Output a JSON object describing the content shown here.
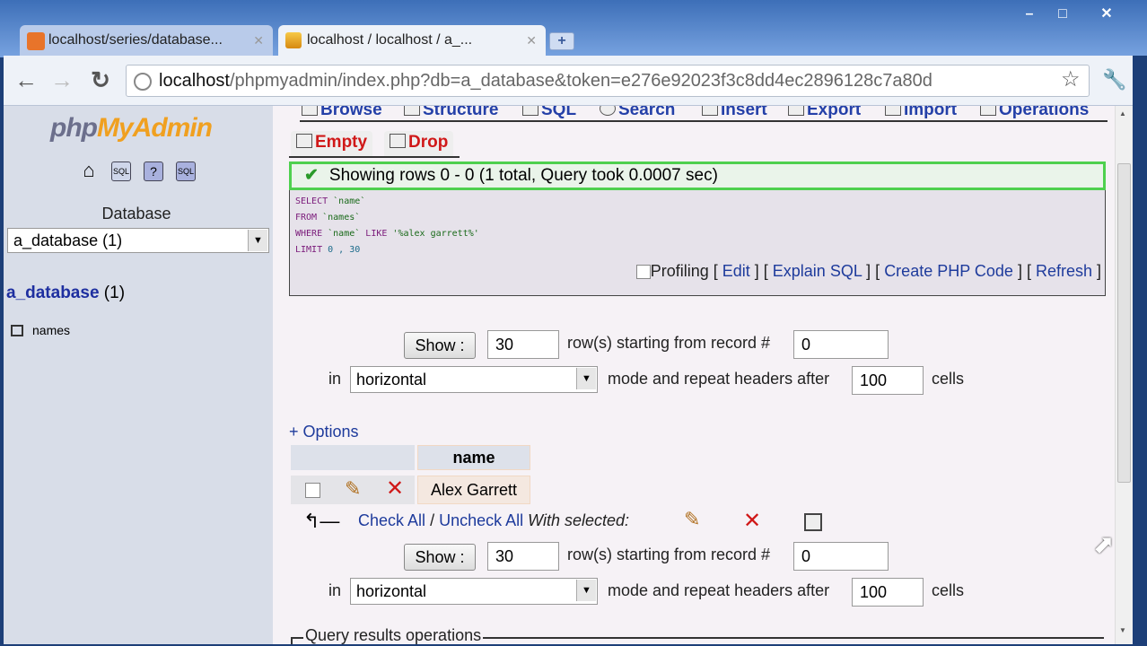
{
  "browser": {
    "tabs": [
      {
        "label": "localhost/series/database...",
        "icon": "xampp-icon",
        "active": false
      },
      {
        "label": "localhost / localhost / a_...",
        "icon": "pma-icon",
        "active": true
      }
    ],
    "url_host": "localhost",
    "url_path": "/phpmyadmin/index.php?db=a_database&token=e276e92023f3c8dd4ec2896128c7a80d"
  },
  "sidebar": {
    "logo_php": "php",
    "logo_myadmin": "MyAdmin",
    "database_label": "Database",
    "database_select": "a_database (1)",
    "db_name": "a_database",
    "db_count": "(1)",
    "tables": [
      "names"
    ]
  },
  "main": {
    "nav_tabs": [
      "Browse",
      "Structure",
      "SQL",
      "Search",
      "Insert",
      "Export",
      "Import",
      "Operations"
    ],
    "danger_tabs": [
      "Empty",
      "Drop"
    ],
    "success_message": "Showing rows 0 - 0 (1 total, Query took 0.0007 sec)",
    "sql": {
      "line1_kw": "SELECT",
      "line1_rest": "`name`",
      "line2_kw": "FROM",
      "line2_rest": "`names`",
      "line3_kw": "WHERE",
      "line3_col": "`name`",
      "line3_op": "LIKE",
      "line3_str": "'%alex garrett%'",
      "line4_kw": "LIMIT",
      "line4_rest": "0 , 30"
    },
    "sql_actions": {
      "profiling": "Profiling",
      "edit": "Edit",
      "explain": "Explain SQL",
      "php": "Create PHP Code",
      "refresh": "Refresh"
    },
    "nav_form": {
      "show_label": "Show :",
      "rows_value": "30",
      "rows_text": "row(s) starting from record #",
      "start_value": "0",
      "in_text": "in",
      "mode_value": "horizontal",
      "mode_text": "mode and repeat headers after",
      "repeat_value": "100",
      "cells_text": "cells"
    },
    "options_label": "+ Options",
    "table": {
      "header": "name",
      "rows": [
        {
          "name": "Alex Garrett"
        }
      ]
    },
    "check_all": "Check All",
    "separator": "/",
    "uncheck_all": "Uncheck All",
    "with_selected": "With selected:",
    "query_ops_label": "Query results operations"
  }
}
